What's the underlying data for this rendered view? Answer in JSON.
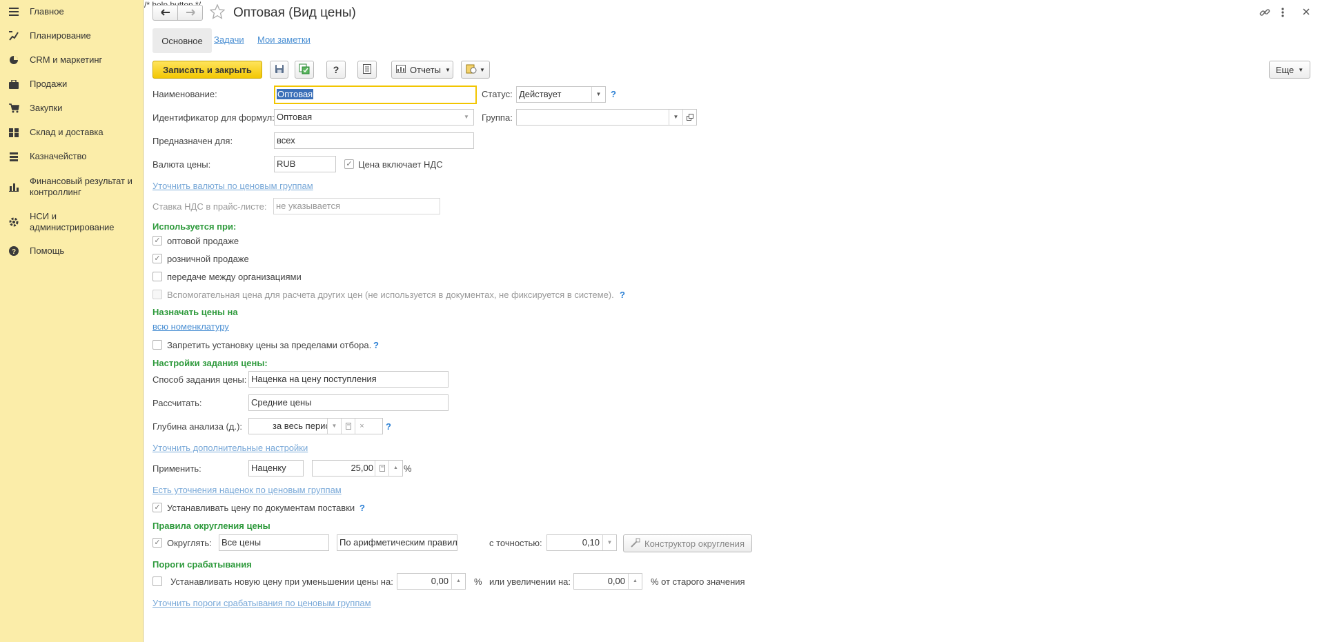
{
  "sidebar": {
    "items": [
      {
        "label": "Главное",
        "icon": "menu-icon"
      },
      {
        "label": "Планирование",
        "icon": "planning-icon"
      },
      {
        "label": "CRM и маркетинг",
        "icon": "pie-chart-icon"
      },
      {
        "label": "Продажи",
        "icon": "briefcase-icon"
      },
      {
        "label": "Закупки",
        "icon": "cart-icon"
      },
      {
        "label": "Склад и доставка",
        "icon": "warehouse-icon"
      },
      {
        "label": "Казначейство",
        "icon": "treasury-icon"
      },
      {
        "label": "Финансовый результат и контроллинг",
        "label_line1": "Финансовый результат и",
        "label_line2": "контроллинг",
        "icon": "bar-chart-icon"
      },
      {
        "label": "НСИ и администрирование",
        "label_line1": "НСИ и",
        "label_line2": "администрирование",
        "icon": "gear-icon"
      },
      {
        "label": "Помощь",
        "icon": "help-icon"
      }
    ]
  },
  "header": {
    "title": "Оптовая (Вид цены)",
    "back_icon": "arrow-left-icon",
    "forward_icon": "arrow-right-icon",
    "favorite_icon": "star-icon"
  },
  "tabs": [
    {
      "label": "Основное",
      "active": true
    },
    {
      "label": "Задачи",
      "active": false
    },
    {
      "label": "Мои заметки",
      "active": false
    }
  ],
  "toolbar": {
    "save_close_label": "Записать и закрыть",
    "reports_label": "Отчеты",
    "help_label": "?",
    "more_label": "Еще"
  },
  "form": {
    "name_label": "Наименование:",
    "name_value": "Оптовая",
    "status_label": "Статус:",
    "status_value": "Действует",
    "formula_id_label": "Идентификатор для формул:",
    "formula_id_value": "Оптовая",
    "group_label": "Группа:",
    "group_value": "",
    "intended_label": "Предназначен для:",
    "intended_value": "всех",
    "currency_label": "Валюта цены:",
    "currency_value": "RUB",
    "vat_included_label": "Цена включает НДС",
    "vat_included_checked": true,
    "clarify_currency_link": "Уточнить валюты по ценовым группам",
    "vat_rate_label": "Ставка НДС в прайс-листе:",
    "vat_rate_placeholder": "не указывается"
  },
  "used_for": {
    "header": "Используется при:",
    "items": [
      {
        "label": "оптовой продаже",
        "checked": true,
        "disabled": false
      },
      {
        "label": "розничной продаже",
        "checked": true,
        "disabled": false
      },
      {
        "label": "передаче между организациями",
        "checked": false,
        "disabled": false
      },
      {
        "label": "Вспомогательная цена для расчета других цен (не используется в документах, не фиксируется в системе).",
        "checked": false,
        "disabled": true
      }
    ]
  },
  "assign": {
    "header": "Назначать цены на",
    "link": "всю номенклатуру",
    "forbid_label": "Запретить установку цены за пределами отбора.",
    "forbid_checked": false
  },
  "price_settings": {
    "header": "Настройки задания цены:",
    "method_label": "Способ задания цены:",
    "method_value": "Наценка на цену поступления",
    "calc_label": "Рассчитать:",
    "calc_value": "Средние цены",
    "depth_label": "Глубина анализа (д.):",
    "depth_value": "за весь период",
    "more_settings_link": "Уточнить дополнительные настройки",
    "apply_label": "Применить:",
    "apply_value": "Наценку",
    "apply_amount": "25,00",
    "percent_sign": "%",
    "markup_groups_link": "Есть уточнения наценок по ценовым группам",
    "set_by_docs_label": "Устанавливать цену по документам поставки",
    "set_by_docs_checked": true
  },
  "rounding": {
    "header": "Правила округления цены",
    "round_label": "Округлять:",
    "round_checked": true,
    "scope_value": "Все цены",
    "rule_value": "По арифметическим правилам",
    "precision_label": "с точностью:",
    "precision_value": "0,10",
    "constructor_label": "Конструктор округления"
  },
  "thresholds": {
    "header": "Пороги срабатывания",
    "decrease_label": "Устанавливать новую цену при уменьшении цены на:",
    "decrease_value": "0,00",
    "percent_sign": "%",
    "increase_label": "или увеличении на:",
    "increase_value": "0,00",
    "suffix_label": "% от старого значения",
    "checked": false,
    "groups_link": "Уточнить пороги срабатывания по ценовым группам"
  }
}
